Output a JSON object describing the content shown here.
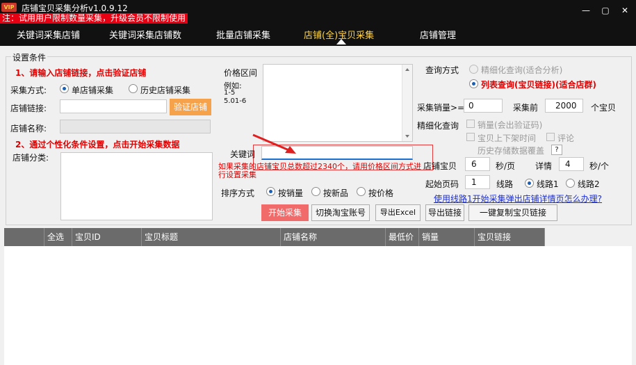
{
  "window": {
    "vip_badge": "VIP",
    "title": "店铺宝贝采集分析v1.0.9.12",
    "notice": "注：试用用户限制数量采集，升级会员不限制使用",
    "min_label": "—",
    "restore_label": "▢",
    "close_label": "✕"
  },
  "tabs": [
    {
      "label": "关键词采集店铺"
    },
    {
      "label": "关键词采集店铺数"
    },
    {
      "label": "批量店铺采集"
    },
    {
      "label": "店铺(全)宝贝采集"
    },
    {
      "label": "店铺管理"
    }
  ],
  "settings": {
    "legend": "设置条件",
    "step1": "1、请输入店铺链接，点击验证店铺",
    "collect_mode_label": "采集方式:",
    "mode_single": "单店铺采集",
    "mode_history": "历史店铺采集",
    "shop_link_label": "店铺链接:",
    "shop_link_value": "",
    "verify_button": "验证店铺",
    "shop_name_label": "店铺名称:",
    "shop_name_value": "",
    "step2": "2、通过个性化条件设置，点击开始采集数据",
    "shop_category_label": "店铺分类:",
    "price_range_label": "价格区间",
    "price_hint_1": "例如:",
    "price_hint_2": "1-5",
    "price_hint_3": "5.01-6",
    "keyword_label": "关键词",
    "keyword_value": "",
    "warning": "如果采集的店铺宝贝总数超过2340个，请用价格区间方式进行设置采集",
    "sort_label": "排序方式",
    "sort_options": [
      "按销量",
      "按新品",
      "按价格"
    ]
  },
  "query": {
    "label": "查询方式",
    "option_fine": "精细化查询(适合分析)",
    "option_list": "列表查询(宝贝链接)(适合店群)",
    "sales_label": "采集销量>=",
    "sales_value": "0",
    "collect_first_label": "采集前",
    "collect_first_value": "2000",
    "collect_first_unit": "个宝贝",
    "fine_query_label": "精细化查询",
    "chk_sales": "销量(会出验证码)",
    "chk_onoff": "宝贝上下架时间",
    "chk_comment": "评论",
    "history_coverage": "历史存储数据覆盖",
    "help_mark": "?",
    "shop_item_label": "店铺宝贝",
    "shop_item_value": "6",
    "sec_per_page": "秒/页",
    "detail_label": "详情",
    "detail_value": "4",
    "sec_per_item": "秒/个",
    "start_page_label": "起始页码",
    "start_page_value": "1",
    "line_label": "线路",
    "line1": "线路1",
    "line2": "线路2",
    "help_link": "使用线路1开始采集弹出店铺详情页怎么办理?"
  },
  "buttons": {
    "start": "开始采集",
    "switch_account": "切换淘宝账号",
    "export_excel": "导出Excel",
    "export_links": "导出链接",
    "copy_links": "一键复制宝贝链接"
  },
  "table": {
    "columns": [
      "",
      "全选",
      "宝贝ID",
      "宝贝标题",
      "店铺名称",
      "最低价",
      "销量",
      "宝贝链接"
    ]
  }
}
